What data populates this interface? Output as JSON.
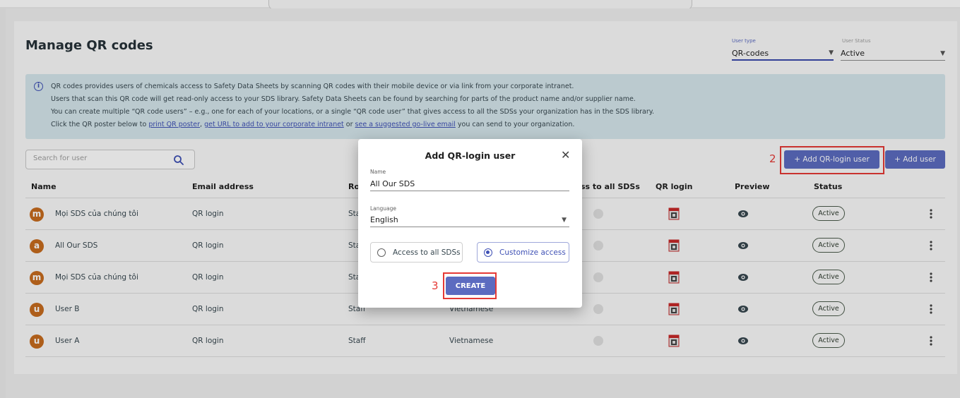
{
  "page": {
    "title": "Manage QR codes"
  },
  "filters": {
    "user_type": {
      "label": "User type",
      "value": "QR-codes"
    },
    "user_status": {
      "label": "User Status",
      "value": "Active"
    }
  },
  "info": {
    "line1": "QR codes provides users of chemicals access to Safety Data Sheets by scanning QR codes with their mobile device or via link from your corporate intranet.",
    "line2": "Users that scan this QR code will get read-only access to your SDS library. Safety Data Sheets can be found by searching for parts of the product name and/or supplier name.",
    "line3": "You can create multiple “QR code users” – e.g., one for each of your locations, or a single “QR code user” that gives access to all the SDSs your organization has in the SDS library.",
    "line4_prefix": "Click the QR poster below to ",
    "link_poster": "print QR poster",
    "sep1": ", ",
    "link_url": "get URL to add to your corporate intranet",
    "sep2": " or ",
    "link_email": "see a suggested go-live email",
    "line4_suffix": " you can send to your organization."
  },
  "search": {
    "placeholder": "Search for user"
  },
  "toolbar": {
    "add_qr_label": "+ Add QR-login user",
    "add_user_label": "+ Add user"
  },
  "annotations": {
    "step2": "2",
    "step3": "3"
  },
  "table": {
    "headers": {
      "name": "Name",
      "email": "Email address",
      "role": "Ro",
      "access": "ss to all SDSs",
      "qr": "QR login",
      "preview": "Preview",
      "status": "Status"
    },
    "rows": [
      {
        "initial": "m",
        "name": "Mọi SDS của chúng tôi",
        "email": "QR login",
        "role": "Sta",
        "language": "",
        "status": "Active"
      },
      {
        "initial": "a",
        "name": "All Our SDS",
        "email": "QR login",
        "role": "Sta",
        "language": "",
        "status": "Active"
      },
      {
        "initial": "m",
        "name": "Mọi SDS của chúng tôi",
        "email": "QR login",
        "role": "Sta",
        "language": "",
        "status": "Active"
      },
      {
        "initial": "u",
        "name": "User B",
        "email": "QR login",
        "role": "Staff",
        "language": "Vietnamese",
        "status": "Active"
      },
      {
        "initial": "u",
        "name": "User A",
        "email": "QR login",
        "role": "Staff",
        "language": "Vietnamese",
        "status": "Active"
      }
    ]
  },
  "dialog": {
    "title": "Add QR-login user",
    "name_label": "Name",
    "name_value": "All Our SDS",
    "language_label": "Language",
    "language_value": "English",
    "option_all": "Access to all SDSs",
    "option_custom": "Customize access",
    "selected_option": "Customize access",
    "create_label": "CREATE"
  },
  "colors": {
    "accent": "#5c6bc0",
    "annotation": "#e53935",
    "avatar": "#c76b1e",
    "info_bg": "#d5e6ec"
  },
  "icons": {
    "info": "info-icon",
    "search": "search-icon",
    "qr": "qr-poster-icon",
    "preview": "eye-icon",
    "more": "kebab-menu-icon",
    "close": "close-icon",
    "dropdown": "chevron-down-icon"
  }
}
